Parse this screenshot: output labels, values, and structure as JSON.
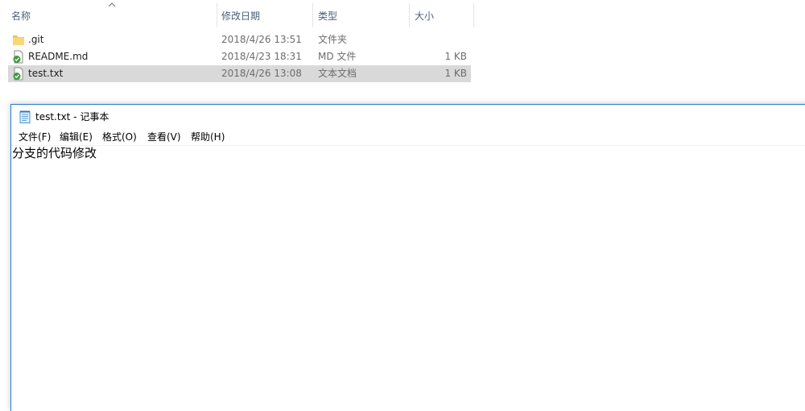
{
  "explorer": {
    "columns": {
      "name": "名称",
      "date": "修改日期",
      "type": "类型",
      "size": "大小"
    },
    "files": [
      {
        "name": ".git",
        "date": "2018/4/26 13:51",
        "type": "文件夹",
        "size": "",
        "icon": "folder-icon"
      },
      {
        "name": "README.md",
        "date": "2018/4/23 18:31",
        "type": "MD 文件",
        "size": "1 KB",
        "icon": "git-tracked-file-icon"
      },
      {
        "name": "test.txt",
        "date": "2018/4/26 13:08",
        "type": "文本文档",
        "size": "1 KB",
        "icon": "git-tracked-file-icon"
      }
    ],
    "selected_file": "test.txt"
  },
  "notepad": {
    "title": "test.txt - 记事本",
    "menu": [
      "文件(F)",
      "编辑(E)",
      "格式(O)",
      "查看(V)",
      "帮助(H)"
    ],
    "content": "分支的代码修改"
  },
  "colors": {
    "selection": "#d9d9d9",
    "window_border": "#2b7bd1",
    "header_text": "#4c607a",
    "secondary_text": "#6d6d6d",
    "folder": "#f8d775",
    "git_check": "#3c9b3c"
  }
}
